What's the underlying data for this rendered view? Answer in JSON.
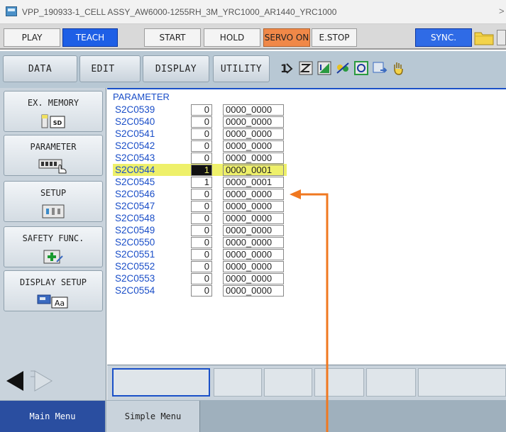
{
  "window": {
    "title": "VPP_190933-1_CELL ASSY_AW6000-1255RH_3M_YRC1000_AR1440_YRC1000",
    "close_glyph": ">"
  },
  "toolbar": {
    "play": "PLAY",
    "teach": "TEACH",
    "start": "START",
    "hold": "HOLD",
    "servo_on": "SERVO ON",
    "estop": "E.STOP",
    "sync": "SYNC."
  },
  "menu": {
    "data": "DATA",
    "edit": "EDIT",
    "display": "DISPLAY",
    "utility": "UTILITY"
  },
  "sidebar": {
    "items": [
      {
        "label": "EX. MEMORY",
        "icon_text": "SD"
      },
      {
        "label": "PARAMETER"
      },
      {
        "label": "SETUP"
      },
      {
        "label": "SAFETY FUNC."
      },
      {
        "label": "DISPLAY SETUP",
        "icon_text": "Aa"
      }
    ]
  },
  "main": {
    "header": "PARAMETER",
    "rows": [
      {
        "name": "S2C0539",
        "value": "0",
        "bits": "0000_0000"
      },
      {
        "name": "S2C0540",
        "value": "0",
        "bits": "0000_0000"
      },
      {
        "name": "S2C0541",
        "value": "0",
        "bits": "0000_0000"
      },
      {
        "name": "S2C0542",
        "value": "0",
        "bits": "0000_0000"
      },
      {
        "name": "S2C0543",
        "value": "0",
        "bits": "0000_0000"
      },
      {
        "name": "S2C0544",
        "value": "1",
        "bits": "0000_0001"
      },
      {
        "name": "S2C0545",
        "value": "1",
        "bits": "0000_0001"
      },
      {
        "name": "S2C0546",
        "value": "0",
        "bits": "0000_0000"
      },
      {
        "name": "S2C0547",
        "value": "0",
        "bits": "0000_0000"
      },
      {
        "name": "S2C0548",
        "value": "0",
        "bits": "0000_0000"
      },
      {
        "name": "S2C0549",
        "value": "0",
        "bits": "0000_0000"
      },
      {
        "name": "S2C0550",
        "value": "0",
        "bits": "0000_0000"
      },
      {
        "name": "S2C0551",
        "value": "0",
        "bits": "0000_0000"
      },
      {
        "name": "S2C0552",
        "value": "0",
        "bits": "0000_0000"
      },
      {
        "name": "S2C0553",
        "value": "0",
        "bits": "0000_0000"
      },
      {
        "name": "S2C0554",
        "value": "0",
        "bits": "0000_0000"
      }
    ]
  },
  "bottom_tabs": {
    "main_menu": "Main Menu",
    "simple_menu": "Simple Menu"
  },
  "colors": {
    "teach_bg": "#1e5fe6",
    "servo_on_bg": "#f08848",
    "sync_bg": "#2f6be6",
    "highlight_row": "#eef06a",
    "annotation_arrow": "#f07820",
    "param_text": "#1a4ec8"
  }
}
